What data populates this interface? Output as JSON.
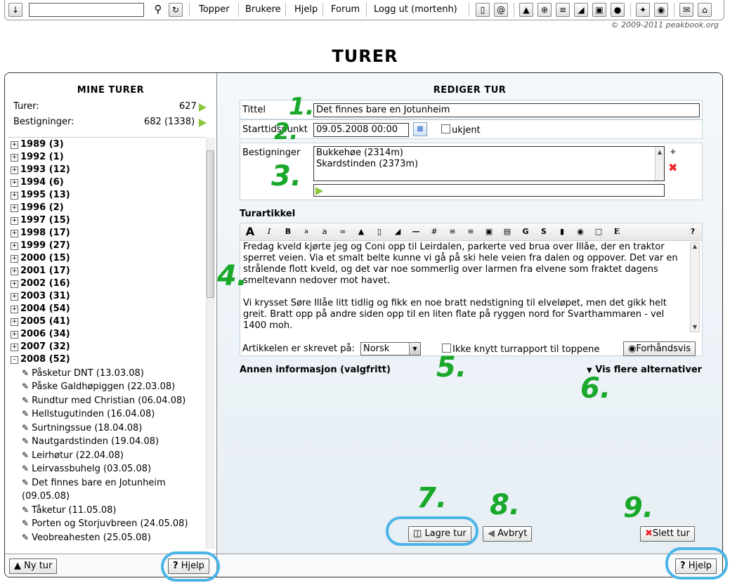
{
  "toolbar": {
    "search_value": "",
    "links": [
      "Topper",
      "Brukere",
      "Hjelp",
      "Forum",
      "Logg ut (mortenh)"
    ],
    "copyright": "© 2009-2011 peakbook.org"
  },
  "page_title": "TURER",
  "left": {
    "heading": "MINE TURER",
    "turer_label": "Turer:",
    "turer_value": "627",
    "bestigninger_label": "Bestigninger:",
    "bestigninger_value": "682 (1338)",
    "years": [
      "1989 (3)",
      "1992 (1)",
      "1993 (12)",
      "1994 (6)",
      "1995 (13)",
      "1996 (2)",
      "1997 (15)",
      "1998 (17)",
      "1999 (27)",
      "2000 (15)",
      "2001 (17)",
      "2002 (16)",
      "2003 (31)",
      "2004 (54)",
      "2005 (41)",
      "2006 (34)",
      "2007 (32)",
      "2008 (52)"
    ],
    "trips": [
      "Påsketur DNT (13.03.08)",
      "Påske Galdhøpiggen (22.03.08)",
      "Rundtur med Christian (06.04.08)",
      "Hellstugutinden (16.04.08)",
      "Surtningssue (18.04.08)",
      "Nautgardstinden (19.04.08)",
      "Leirhøtur (22.04.08)",
      "Leirvassbuhelg (03.05.08)",
      "Det finnes bare en Jotunheim",
      "(09.05.08)",
      "Tåketur (11.05.08)",
      "Porten og Storjuvbreen (24.05.08)",
      "Veobreahesten (25.05.08)"
    ],
    "new_trip_label": "Ny tur",
    "help_label": "Hjelp"
  },
  "right": {
    "heading": "REDIGER TUR",
    "title_label": "Tittel",
    "title_value": "Det finnes bare en Jotunheim",
    "start_label": "Starttidspunkt",
    "start_value": "09.05.2008 00:00",
    "unknown_label": "ukjent",
    "ascents_label": "Bestigninger",
    "ascents": [
      "Bukkehøe (2314m)",
      "Skardstinden (2373m)"
    ],
    "article_label": "Turartikkel",
    "article_text": "Fredag kveld kjørte jeg og Coni opp til Leirdalen, parkerte ved brua over Illåe, der en traktor sperret veien. Via et smalt belte kunne vi gå på ski hele veien fra dalen og oppover. Det var en strålende flott kveld, og det var noe sommerlig over larmen fra elvene som fraktet dagens smeltevann nedover mot havet.\n\nVi krysset Søre Illåe litt tidlig og fikk en noe bratt nedstigning til elveløpet, men det gikk helt greit. Bratt opp på andre siden opp til en liten flate på ryggen nord for Svarthammaren - vel 1400 moh.",
    "language_label": "Artikkelen er skrevet på:",
    "language_value": "Norsk",
    "no_link_label": "Ikke knytt turrapport til toppene",
    "preview_label": "Forhåndsvis",
    "other_info_label": "Annen informasjon (valgfritt)",
    "more_options_label": "Vis flere alternativer",
    "save_label": "Lagre tur",
    "cancel_label": "Avbryt",
    "delete_label": "Slett tur",
    "help_label": "Hjelp"
  },
  "annotations": [
    "1.",
    "2.",
    "3.",
    "4.",
    "5.",
    "6.",
    "7.",
    "8.",
    "9."
  ],
  "colors": {
    "annotation_green": "#1aa82a",
    "highlight_blue": "#4bb4e6",
    "play_green": "#8dc63f"
  }
}
